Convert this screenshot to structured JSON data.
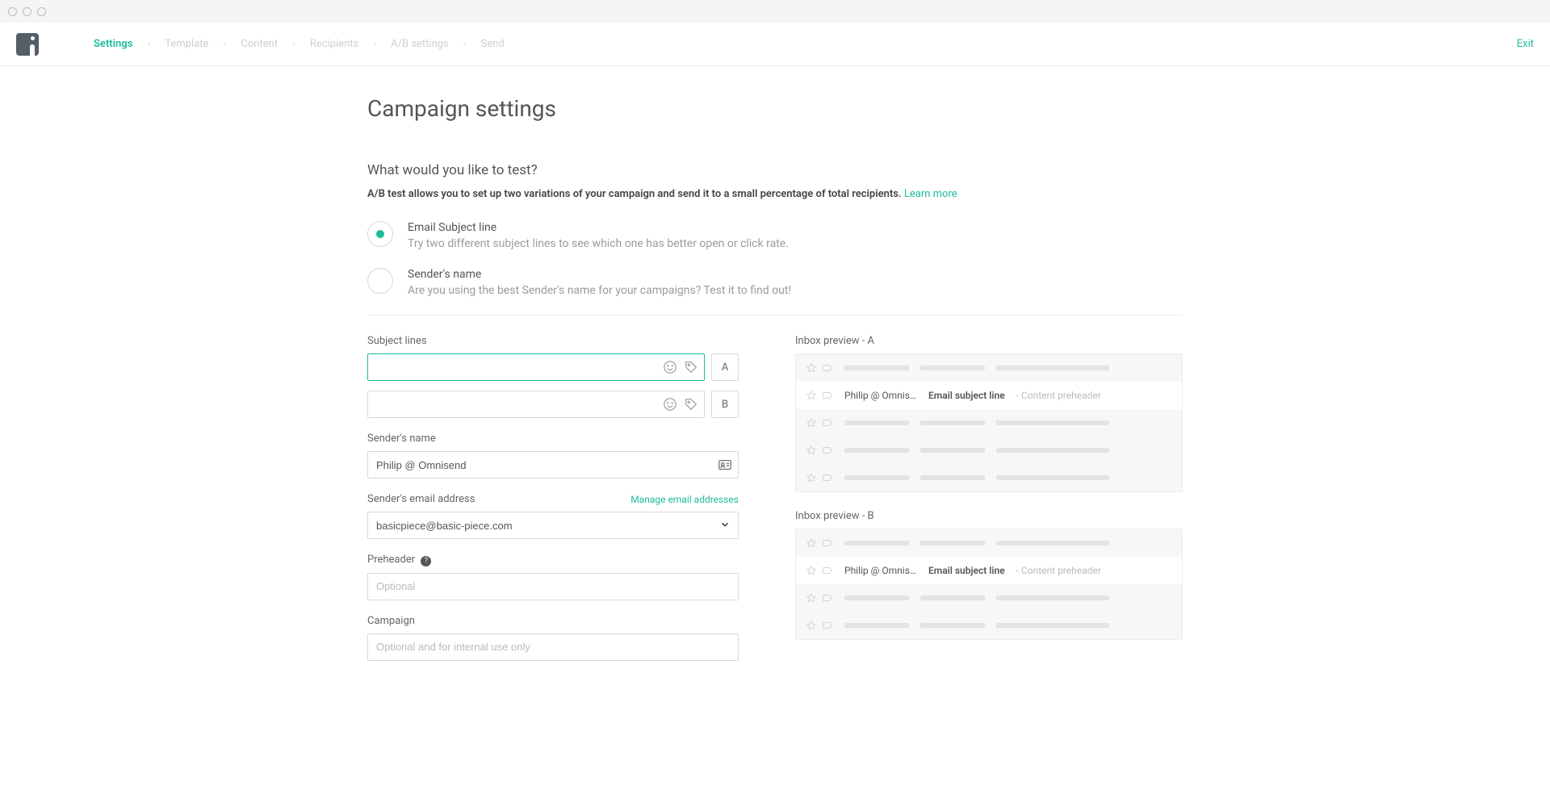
{
  "breadcrumbs": [
    "Settings",
    "Template",
    "Content",
    "Recipients",
    "A/B settings",
    "Send"
  ],
  "active_crumb": 0,
  "exit": "Exit",
  "title": "Campaign settings",
  "question": "What would you like to test?",
  "description": "A/B test allows you to set up two variations of your campaign and send it to a small percentage of total recipients.",
  "learn_more": "Learn more",
  "options": [
    {
      "title": "Email Subject line",
      "desc": "Try two different subject lines to see which one has better open or click rate.",
      "selected": true
    },
    {
      "title": "Sender's name",
      "desc": "Are you using the best Sender's name for your campaigns? Test it to find out!",
      "selected": false
    }
  ],
  "subject_lines_label": "Subject lines",
  "subject_a": "",
  "subject_b": "",
  "variant_a": "A",
  "variant_b": "B",
  "sender_name_label": "Sender's name",
  "sender_name": "Philip @ Omnisend",
  "sender_email_label": "Sender's email address",
  "sender_email_link": "Manage email addresses",
  "sender_email": "basicpiece@basic-piece.com",
  "preheader_label": "Preheader",
  "preheader_placeholder": "Optional",
  "campaign_label": "Campaign",
  "campaign_placeholder": "Optional and for internal use only",
  "preview_a_title": "Inbox preview - A",
  "preview_b_title": "Inbox preview - B",
  "preview_sender": "Philip @ Omnise…",
  "preview_subject": "Email subject line",
  "preview_preheader": "Content preheader"
}
